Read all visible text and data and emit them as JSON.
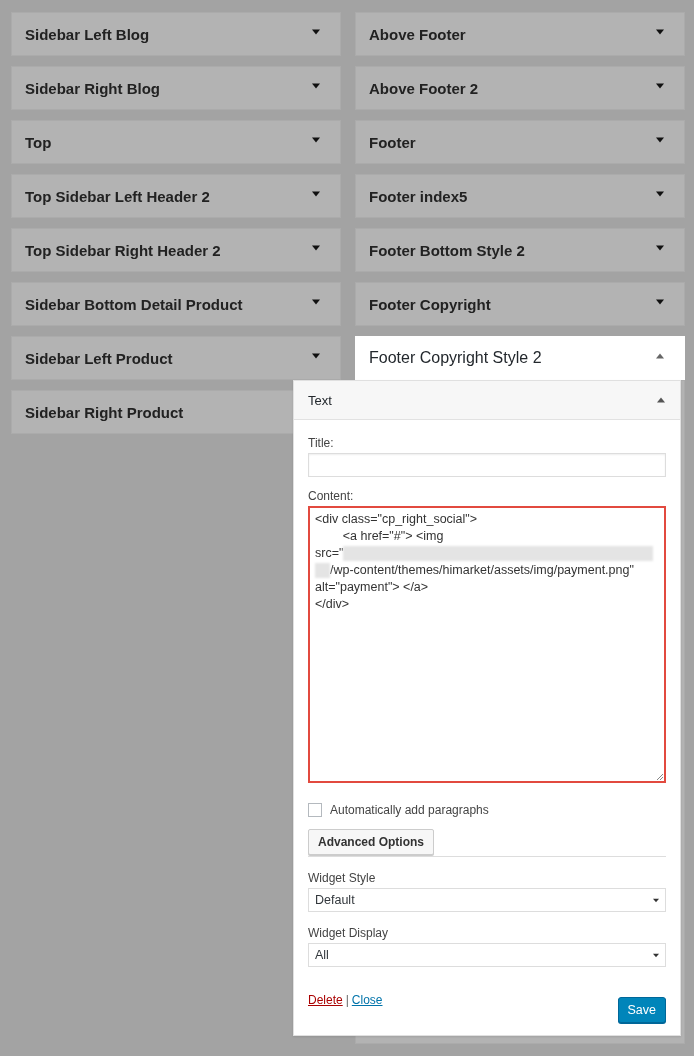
{
  "sidebars": {
    "left": [
      {
        "name": "Sidebar Left Blog",
        "expanded": false
      },
      {
        "name": "Sidebar Right Blog",
        "expanded": false
      },
      {
        "name": "Top",
        "expanded": false
      },
      {
        "name": "Top Sidebar Left Header 2",
        "expanded": false
      },
      {
        "name": "Top Sidebar Right Header 2",
        "expanded": false
      },
      {
        "name": "Sidebar Bottom Detail Product",
        "expanded": false
      },
      {
        "name": "Sidebar Left Product",
        "expanded": false
      },
      {
        "name": "Sidebar Right Product",
        "expanded": false
      }
    ],
    "right": [
      {
        "name": "Above Footer",
        "expanded": false
      },
      {
        "name": "Above Footer 2",
        "expanded": false
      },
      {
        "name": "Footer",
        "expanded": false
      },
      {
        "name": "Footer index5",
        "expanded": false
      },
      {
        "name": "Footer Bottom Style 2",
        "expanded": false
      },
      {
        "name": "Footer Copyright",
        "expanded": false
      },
      {
        "name": "Footer Copyright Style 2",
        "expanded": true
      }
    ]
  },
  "widget": {
    "title": "Text",
    "expanded": true,
    "title_label": "Title:",
    "content_label": "Content:",
    "content_lines": [
      {
        "segments": [
          {
            "kind": "text",
            "text": "<div class=\"cp_right_social\">"
          }
        ]
      },
      {
        "segments": [
          {
            "kind": "text",
            "text": "\t<a href=\"#\"> <img"
          }
        ]
      },
      {
        "segments": [
          {
            "kind": "text",
            "text": "src=\""
          },
          {
            "kind": "blurred"
          }
        ]
      },
      {
        "segments": [
          {
            "kind": "blurred"
          },
          {
            "kind": "text",
            "text": "/wp-content/themes/himarket/assets/img/payment.png\""
          }
        ]
      },
      {
        "segments": [
          {
            "kind": "text",
            "text": "alt=\"payment\"> </a>"
          }
        ]
      },
      {
        "segments": [
          {
            "kind": "text",
            "text": "</div>"
          }
        ]
      }
    ],
    "auto_paragraphs": {
      "label": "Automatically add paragraphs",
      "checked": false
    },
    "advanced_button": "Advanced Options",
    "widget_style": {
      "label": "Widget Style",
      "value": "Default"
    },
    "widget_display": {
      "label": "Widget Display",
      "value": "All"
    },
    "delete_link": "Delete",
    "separator": "|",
    "close_link": "Close",
    "save_button": "Save"
  }
}
